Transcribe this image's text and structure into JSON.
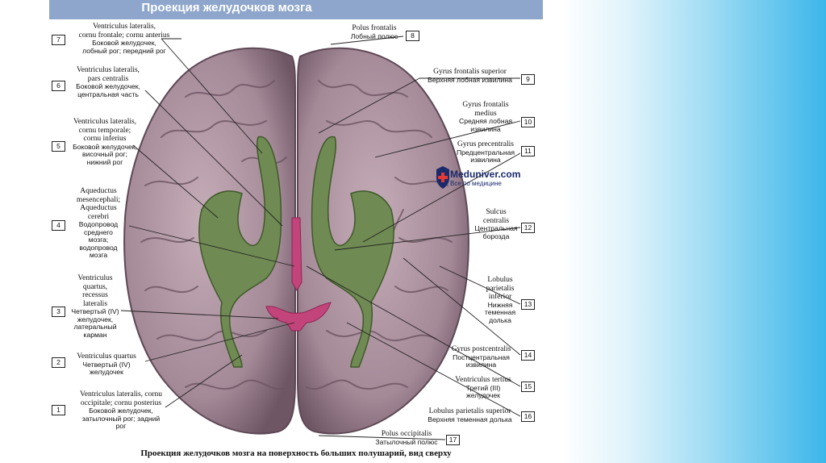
{
  "header_title": "Проекция желудочков мозга",
  "caption": "Проекция желудочков мозга на поверхность больших полушарий, вид сверху",
  "logo": {
    "main": "Meduniver.com",
    "sub": "Все по медицине"
  },
  "colors": {
    "header": "#8ea6cc",
    "brain": "#a98e9b",
    "ventricles": "#6f8a52",
    "third_ventricle": "#c2447a",
    "background_right": "#3cb6ea"
  },
  "labels": {
    "l7": {
      "num": "7",
      "lat": [
        "Ventriculus lateralis,",
        "cornu frontale; cornu anterius"
      ],
      "ru": [
        "Боковой желудочек,",
        "лобный рог; передний рог"
      ]
    },
    "l6": {
      "num": "6",
      "lat": [
        "Ventriculus lateralis,",
        "pars centralis"
      ],
      "ru": [
        "Боковой желудочек,",
        "центральная часть"
      ]
    },
    "l5": {
      "num": "5",
      "lat": [
        "Ventriculus lateralis,",
        "cornu temporale;",
        "cornu inferius"
      ],
      "ru": [
        "Боковой желудочек,",
        "височный рог;",
        "нижний рог"
      ]
    },
    "l4": {
      "num": "4",
      "lat": [
        "Aqueductus",
        "mesencephali;",
        "Aqueductus",
        "cerebri"
      ],
      "ru": [
        "Водопровод",
        "среднего",
        "мозга;",
        "водопровод",
        "мозга"
      ]
    },
    "l3": {
      "num": "3",
      "lat": [
        "Ventriculus",
        "quartus,",
        "recessus",
        "lateralis"
      ],
      "ru": [
        "Четвертый (IV)",
        "желудочек,",
        "латеральный",
        "карман"
      ]
    },
    "l2": {
      "num": "2",
      "lat": [
        "Ventriculus quartus"
      ],
      "ru": [
        "Четвертый (IV)",
        "желудочек"
      ]
    },
    "l1": {
      "num": "1",
      "lat": [
        "Ventriculus lateralis, cornu",
        "occipitale; cornu posterius"
      ],
      "ru": [
        "Боковой желудочек,",
        "затылочный рог; задний",
        "рог"
      ]
    },
    "l8": {
      "num": "8",
      "lat": [
        "Polus frontalis"
      ],
      "ru": [
        "Лобный полюс"
      ]
    },
    "l9": {
      "num": "9",
      "lat": [
        "Gyrus frontalis superior"
      ],
      "ru": [
        "Верхняя лобная извилина"
      ]
    },
    "l10": {
      "num": "10",
      "lat": [
        "Gyrus frontalis",
        "medius"
      ],
      "ru": [
        "Средняя лобная",
        "извилина"
      ]
    },
    "l11": {
      "num": "11",
      "lat": [
        "Gyrus precentralis"
      ],
      "ru": [
        "Предцентральная",
        "извилина"
      ]
    },
    "l12": {
      "num": "12",
      "lat": [
        "Sulcus",
        "centralis"
      ],
      "ru": [
        "Центральная",
        "борозда"
      ]
    },
    "l13": {
      "num": "13",
      "lat": [
        "Lobulus",
        "parietalis",
        "inferior"
      ],
      "ru": [
        "Нижняя",
        "теменная",
        "долька"
      ]
    },
    "l14": {
      "num": "14",
      "lat": [
        "Gyrus postcentralis"
      ],
      "ru": [
        "Постцентральная",
        "извилина"
      ]
    },
    "l15": {
      "num": "15",
      "lat": [
        "Ventriculus tertius"
      ],
      "ru": [
        "Третий (III)",
        "желудочек"
      ]
    },
    "l16": {
      "num": "16",
      "lat": [
        "Lobulus parietalis superior"
      ],
      "ru": [
        "Верхняя теменная долька"
      ]
    },
    "l17": {
      "num": "17",
      "lat": [
        "Polus occipitalis"
      ],
      "ru": [
        "Затылочный полюс"
      ]
    }
  }
}
